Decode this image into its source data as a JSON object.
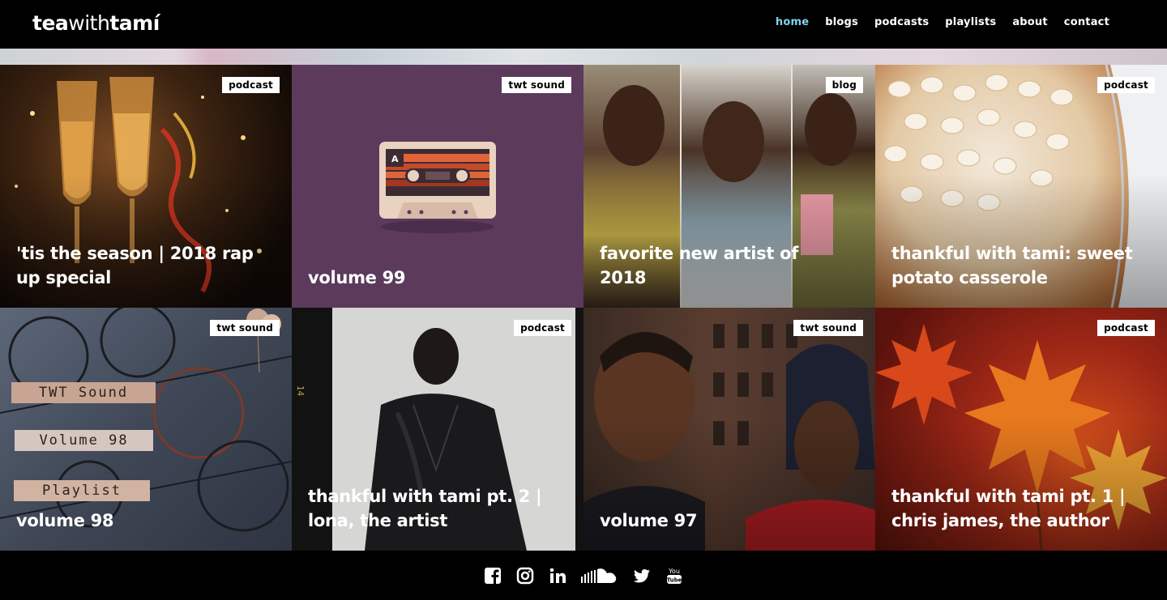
{
  "header": {
    "logo_bold_1": "tea",
    "logo_light": "with",
    "logo_bold_2": "tamí",
    "nav": [
      {
        "label": "home",
        "active": true
      },
      {
        "label": "blogs"
      },
      {
        "label": "podcasts"
      },
      {
        "label": "playlists"
      },
      {
        "label": "about"
      },
      {
        "label": "contact"
      }
    ]
  },
  "tiles": [
    {
      "tag": "podcast",
      "title": "'tis the season | 2018 rap up special",
      "image": "champagne-glasses-image"
    },
    {
      "tag": "twt sound",
      "title": "volume 99",
      "image": "cassette-tape-image"
    },
    {
      "tag": "blog",
      "title": "favorite new artist of 2018",
      "image": "artists-collage-image"
    },
    {
      "tag": "podcast",
      "title": "thankful with tami: sweet potato casserole",
      "image": "casserole-image"
    },
    {
      "tag": "twt sound",
      "title": "volume 98",
      "image": "eyeglasses-image",
      "labels": [
        "TWT Sound",
        "Volume 98",
        "Playlist"
      ]
    },
    {
      "tag": "podcast",
      "title": "thankful with tami pt. 2 | lona, the artist",
      "image": "artist-portrait-image",
      "film_number": "14"
    },
    {
      "tag": "twt sound",
      "title": "volume 97",
      "image": "movie-still-image"
    },
    {
      "tag": "podcast",
      "title": "thankful with tami pt. 1 | chris james, the author",
      "image": "autumn-leaves-image"
    }
  ],
  "cassette": {
    "side_label": "A"
  },
  "social": [
    "facebook-icon",
    "instagram-icon",
    "linkedin-icon",
    "soundcloud-icon",
    "twitter-icon",
    "youtube-icon"
  ],
  "youtube_text": "You Tube",
  "colors": {
    "nav_active": "#7fd3f0",
    "tile_purple": "#5b3a5c",
    "background": "#000000"
  }
}
